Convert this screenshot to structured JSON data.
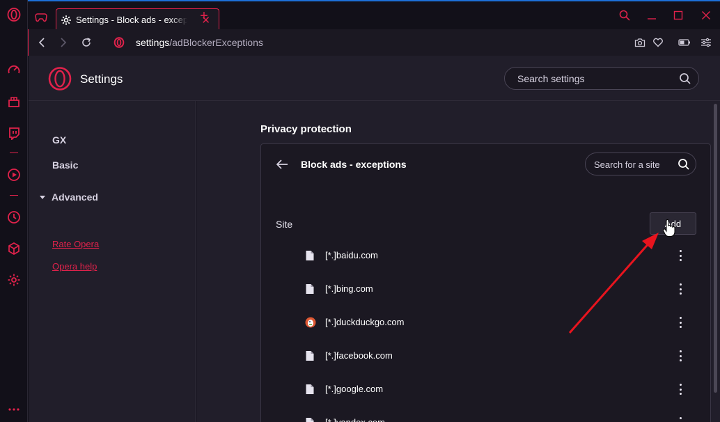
{
  "window": {
    "tab_title": "Settings - Block ads - exceptions",
    "url_host": "settings",
    "url_path": "/adBlockerExceptions"
  },
  "settings": {
    "title": "Settings",
    "search_placeholder": "Search settings"
  },
  "menu": {
    "items": [
      {
        "label": "GX"
      },
      {
        "label": "Basic"
      }
    ],
    "advanced_label": "Advanced",
    "links": [
      {
        "label": "Rate Opera"
      },
      {
        "label": "Opera help"
      }
    ]
  },
  "content": {
    "section_title": "Privacy protection",
    "card_title": "Block ads - exceptions",
    "site_search_placeholder": "Search for a site",
    "site_label": "Site",
    "add_label": "Add",
    "sites": [
      {
        "name": "[*.]baidu.com",
        "favicon": "file-icon"
      },
      {
        "name": "[*.]bing.com",
        "favicon": "file-icon"
      },
      {
        "name": "[*.]duckduckgo.com",
        "favicon": "duckduckgo-icon"
      },
      {
        "name": "[*.]facebook.com",
        "favicon": "file-icon"
      },
      {
        "name": "[*.]google.com",
        "favicon": "file-icon"
      },
      {
        "name": "[*.]yandex.com",
        "favicon": "file-icon"
      }
    ]
  },
  "colors": {
    "accent": "#e0224b",
    "background": "#211e2a",
    "card": "#1b1822"
  }
}
